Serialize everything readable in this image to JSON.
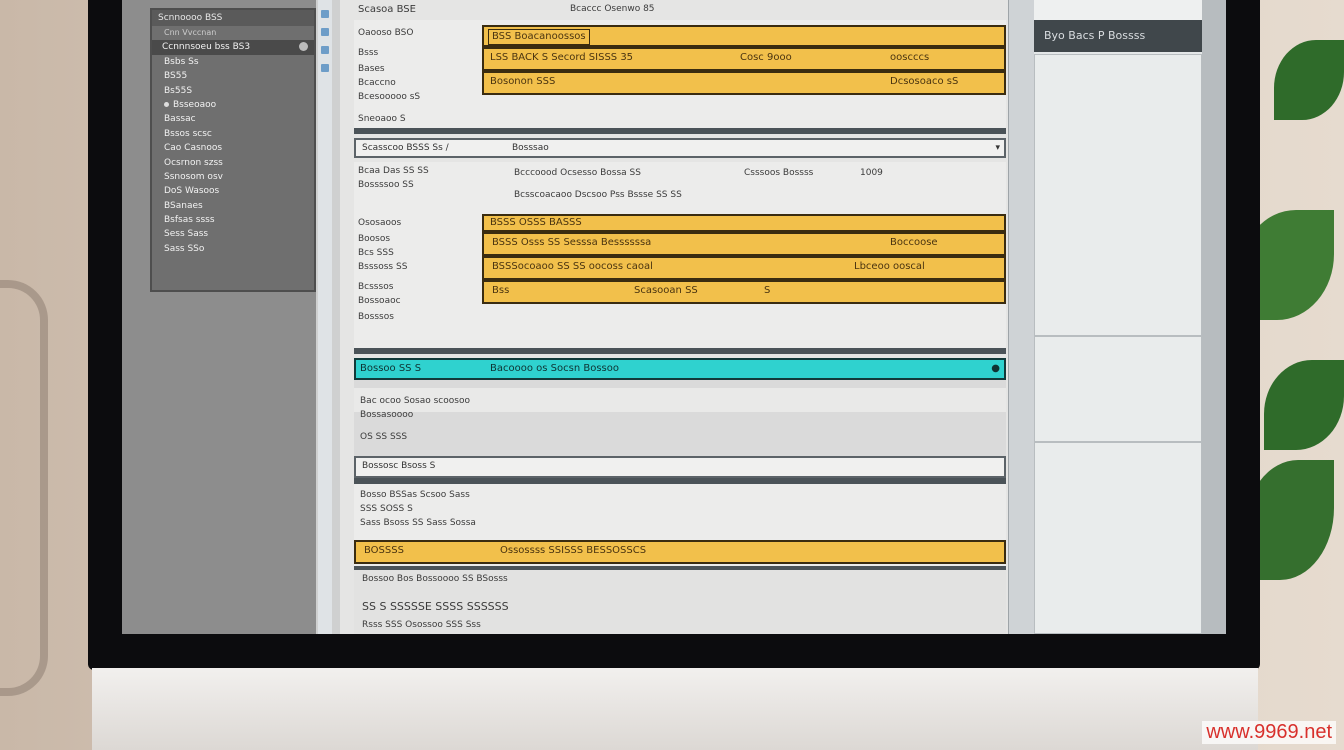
{
  "sidebar": {
    "tree_header": "Scnnoooo BSS",
    "tree_subheader": "Cnn  Vvccnan",
    "items": [
      {
        "label": "Ccnnnsoeu bss BS3",
        "selected": true
      },
      {
        "label": "Bsbs Ss"
      },
      {
        "label": "BS55"
      },
      {
        "label": "Bs55S"
      },
      {
        "label": "Bsseoaoo"
      },
      {
        "label": "Bassac"
      },
      {
        "label": "Bssos scsc"
      },
      {
        "label": "Cao Casnoos"
      },
      {
        "label": "Ocsrnon szss"
      },
      {
        "label": "Ssnosom osv"
      },
      {
        "label": "DoS Wasoos"
      },
      {
        "label": "BSanaes"
      },
      {
        "label": "Bsfsas ssss"
      },
      {
        "label": "Sess Sass"
      },
      {
        "label": "Sass SSo"
      }
    ]
  },
  "main": {
    "top_title": "Scasoa BSE",
    "top_label": "Bcaccc   Osenwo  85",
    "section1": {
      "labels": [
        "Oaooso   BSO",
        "Bsss",
        "Bases",
        "Bcaccno",
        "Bcesooooo sS",
        "Sneoaoo S"
      ],
      "rows": [
        {
          "c1": "BSS Boacanoossos",
          "c2": "",
          "c3": ""
        },
        {
          "c1": "LSS BACK S Secord SISSS 35",
          "c2": "Cosc  9ooo",
          "c3": "ooscccs"
        },
        {
          "c1": "Bosonon  SSS",
          "c2": "",
          "c3": "Dcsosoaco  sS"
        }
      ]
    },
    "bar1": {
      "left": "Scasscoo  BSSS  Ss  /",
      "right": "Bosssao"
    },
    "section2": {
      "labels": [
        "Bcaa  Das  SS SS",
        "Bossssoo  SS",
        "Ososaoos",
        "Boosos",
        "Bcs SSS",
        "Bsssoss SS",
        "Bcsssos",
        "Bossoaoc",
        "Bosssos"
      ],
      "info1": "Bcccoood Ocsesso Bossa  SS",
      "info2": "Csssoos Bossss",
      "info3": "1009",
      "info4": "Bcsscoacaoo Dscsoo Pss   Bssse  SS  SS",
      "rows": [
        {
          "c1": "BSSS OSSS  BASSS",
          "c2": "",
          "c3": ""
        },
        {
          "c1": "BSSS Osss SS Sesssa Bessssssa",
          "c2": "",
          "c3": "Boccoose"
        },
        {
          "c1": "BSSSocoaoo SS  SS oocoss caoal",
          "c2": "",
          "c3": "Lbceoo ooscal"
        },
        {
          "c1": "Bss",
          "c2": "Scasooan  SS",
          "c3": "S"
        }
      ]
    },
    "section3": {
      "header_left": "Bossoo SS  S",
      "header_mid": "Bacoooo os Socsn Bossoo",
      "labels": [
        "Bac ocoo  Sosao scoosoo",
        "Bossasoooo",
        "OS  SS SSS"
      ]
    },
    "bar2": {
      "left": "Bossosc  Bsoss  S"
    },
    "section4": {
      "labels": [
        "Bosso  BSSas Scsoo Sass",
        "SSS  SOSS  S",
        "Sass  Bsoss  SS  Sass  Sossa"
      ],
      "row": {
        "c1": "BOSSSS",
        "c2": "Ossossss SSISSS BESSOSSCS"
      }
    },
    "footer": {
      "line1": "Bossoo  Bos  Bossoooo  SS  BSosss",
      "line2": "SS  S  SSSSSE  SSSS  SSSSSS",
      "line3": "Rsss  SSS      Osossoo  SSS  Sss"
    }
  },
  "right_panel": {
    "title": "Byo   Bacs   P Bossss"
  },
  "watermark": "www.9969.net",
  "colors": {
    "highlight_row": "#f2c04b",
    "active_row": "#2fd2cf",
    "panel_head": "#40474b"
  }
}
